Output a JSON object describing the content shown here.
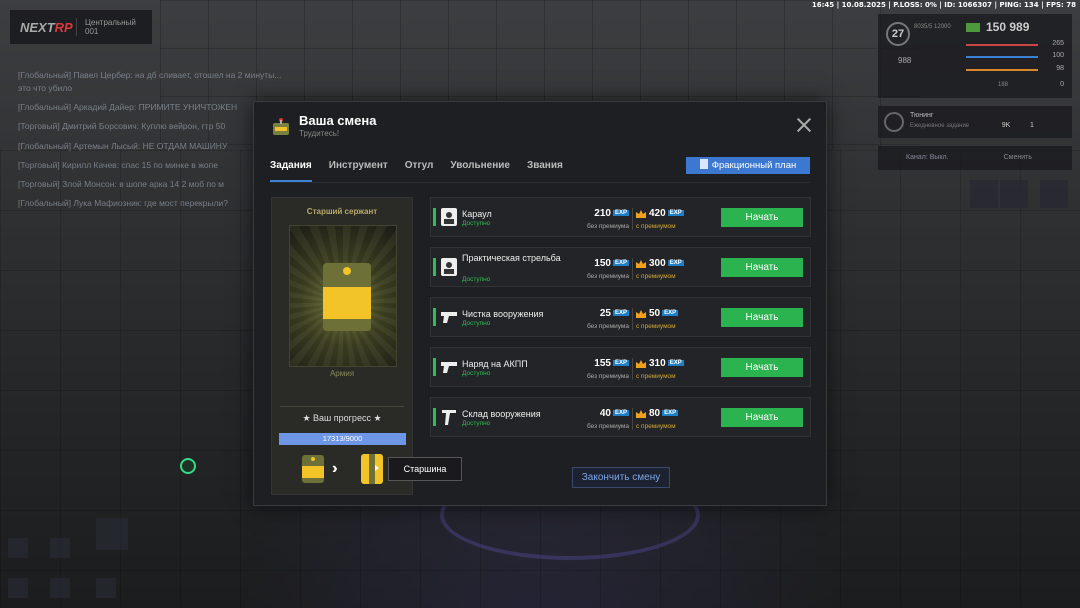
{
  "status_bar": "16:45 | 10.08.2025 | P.LOSS: 0% | ID: 1066307 | PING: 134 | FPS: 78",
  "logo": {
    "brand_a": "NEXT",
    "brand_b": "RP",
    "server_line1": "Центральный",
    "server_line2": "001"
  },
  "chat": [
    "[Глобальный] Павел Цербер: на дб сливает, отошел на 2 минуты...",
    "это что убило",
    "[Глобальный] Аркадий Дайер: ПРИМИТЕ УНИЧТОЖЕН",
    "[Торговый] Дмитрий Борсович: Куплю вейрон, гтр 50",
    "[Глобальный] Артемын Лысый: НЕ ОТДАМ МАШИНУ",
    "[Торговый] Кирилл Качев: спас 15 по минке в жопе",
    "[Торговый] Злой Монсон: в шопе арка 14 2 моб по м",
    "[Глобальный] Лука Мафиозник: где мост перекрыли?"
  ],
  "hud": {
    "level": "27",
    "level_text": "8035/5\n12000",
    "money": "150 989",
    "cash2": "988",
    "stat1": "265",
    "stat2": "100",
    "stat3": "98",
    "stat4": "0",
    "stat5": "188",
    "tuning_title": "Тюнинг",
    "tuning_sub": "Ежедневное задание",
    "tuning_v1": "9K",
    "tuning_v2": "1",
    "channel": "Канал: Выкл.",
    "channel_switch": "Сменить"
  },
  "modal": {
    "title": "Ваша смена",
    "subtitle": "Трудитесь!",
    "tabs": [
      "Задания",
      "Инструмент",
      "Отгул",
      "Увольнение",
      "Звания"
    ],
    "faction_plan": "Фракционный план",
    "rank": {
      "name": "Старший сержант",
      "faction": "Армия",
      "progress_label": "★ Ваш прогресс ★",
      "progress_text": "17313/9000",
      "progress_fraction": 1.0,
      "next_rank_tooltip": "Старшина"
    },
    "exp_tag": "EXP",
    "label_no_premium": "без премиума",
    "label_premium": "с премиумом",
    "start_label": "Начать",
    "tasks": [
      {
        "name": "Караул",
        "status": "Доступно",
        "exp": "210",
        "exp_premium": "420",
        "icon": "guard-icon"
      },
      {
        "name": "Практическая стрельба",
        "status": "Доступно",
        "exp": "150",
        "exp_premium": "300",
        "icon": "target-icon"
      },
      {
        "name": "Чистка вооружения",
        "status": "Доступно",
        "exp": "25",
        "exp_premium": "50",
        "icon": "gun-icon"
      },
      {
        "name": "Наряд на АКПП",
        "status": "Доступно",
        "exp": "155",
        "exp_premium": "310",
        "icon": "gun-icon"
      },
      {
        "name": "Склад вооружения",
        "status": "Доступно",
        "exp": "40",
        "exp_premium": "80",
        "icon": "rifle-icon"
      }
    ],
    "finish_label": "Закончить смену"
  },
  "colors": {
    "accent_green": "#2bb34f",
    "accent_blue": "#3d78d0",
    "rank_yellow": "#f0c12c"
  }
}
